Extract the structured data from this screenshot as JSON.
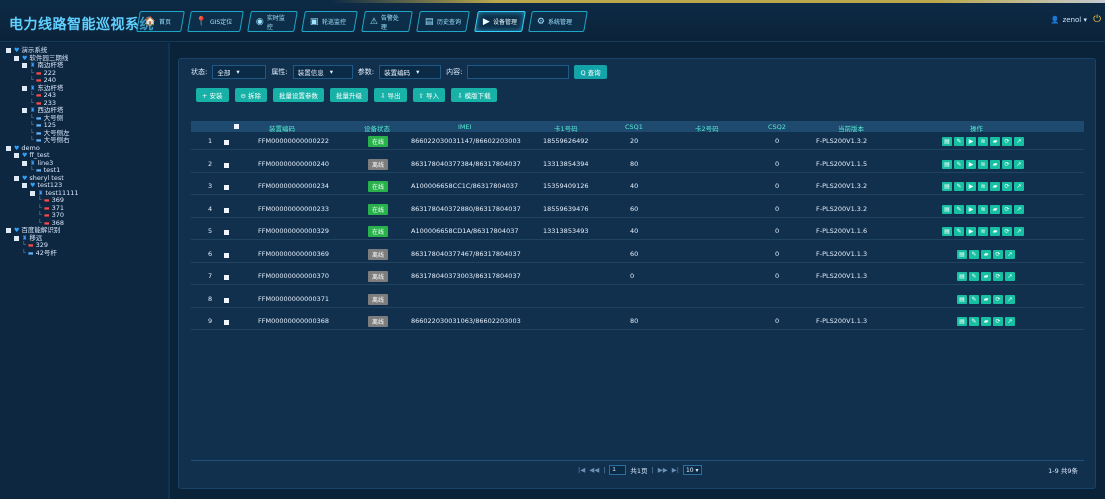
{
  "app_title": "电力线路智能巡视系统",
  "nav": [
    {
      "label": "首页",
      "icon": "home-icon",
      "glyph": "🏠"
    },
    {
      "label": "GIS定位",
      "icon": "map-pin-icon",
      "glyph": "📍"
    },
    {
      "label": "实时监控",
      "icon": "camera-icon",
      "glyph": "◉"
    },
    {
      "label": "轮巡监控",
      "icon": "video-icon",
      "glyph": "▣"
    },
    {
      "label": "告警处理",
      "icon": "warning-icon",
      "glyph": "⚠"
    },
    {
      "label": "历史查询",
      "icon": "calendar-icon",
      "glyph": "▤"
    },
    {
      "label": "设备管理",
      "icon": "device-icon",
      "glyph": "▶"
    },
    {
      "label": "系统管理",
      "icon": "gear-icon",
      "glyph": "⚙"
    }
  ],
  "user": {
    "name": "zenol ▾",
    "icon": "user-icon",
    "power_icon": "power-icon"
  },
  "tree": [
    {
      "t": "演示系统",
      "level": 0,
      "kind": "pin"
    },
    {
      "t": "软件园三期线",
      "level": 1,
      "kind": "pin"
    },
    {
      "t": "南边杆塔",
      "level": 2,
      "kind": "bar"
    },
    {
      "t": "222",
      "level": 3,
      "kind": "dev-red"
    },
    {
      "t": "240",
      "level": 3,
      "kind": "dev-red"
    },
    {
      "t": "东边杆塔",
      "level": 2,
      "kind": "bar"
    },
    {
      "t": "243",
      "level": 3,
      "kind": "dev-red"
    },
    {
      "t": "233",
      "level": 3,
      "kind": "dev-red"
    },
    {
      "t": "西边杆塔",
      "level": 2,
      "kind": "bar"
    },
    {
      "t": "大号侧",
      "level": 3,
      "kind": "dev-blue"
    },
    {
      "t": "125",
      "level": 3,
      "kind": "dev-blue"
    },
    {
      "t": "大号侧左",
      "level": 3,
      "kind": "dev-blue"
    },
    {
      "t": "大号侧右",
      "level": 3,
      "kind": "dev-blue"
    },
    {
      "t": "demo",
      "level": 0,
      "kind": "pin"
    },
    {
      "t": "ff_test",
      "level": 1,
      "kind": "pin"
    },
    {
      "t": "line3",
      "level": 2,
      "kind": "bar"
    },
    {
      "t": "test1",
      "level": 3,
      "kind": "dev-blue"
    },
    {
      "t": "sheryl test",
      "level": 1,
      "kind": "pin"
    },
    {
      "t": "test123",
      "level": 2,
      "kind": "pin"
    },
    {
      "t": "test11111",
      "level": 3,
      "kind": "bar"
    },
    {
      "t": "369",
      "level": 4,
      "kind": "dev-red"
    },
    {
      "t": "371",
      "level": 4,
      "kind": "dev-red"
    },
    {
      "t": "370",
      "level": 4,
      "kind": "dev-red"
    },
    {
      "t": "368",
      "level": 4,
      "kind": "dev-red"
    },
    {
      "t": "百度能解识别",
      "level": 0,
      "kind": "pin"
    },
    {
      "t": "移远",
      "level": 1,
      "kind": "bar"
    },
    {
      "t": "329",
      "level": 2,
      "kind": "dev-red"
    },
    {
      "t": "42号杆",
      "level": 2,
      "kind": "dev-blue"
    }
  ],
  "filters": {
    "status_label": "状态:",
    "status_value": "全部",
    "attr_label": "属性:",
    "attr_value": "装置信息",
    "param_label": "参数:",
    "param_value": "装置编码",
    "content_label": "内容:",
    "content_value": "",
    "query_label": "Q 查询"
  },
  "actions": [
    {
      "label": "+ 安装",
      "name": "install-button"
    },
    {
      "label": "⊖ 拆除",
      "name": "remove-button"
    },
    {
      "label": "批量设置参数",
      "name": "batch-params-button"
    },
    {
      "label": "批量升级",
      "name": "batch-upgrade-button"
    },
    {
      "label": "⇩ 导出",
      "name": "export-button"
    },
    {
      "label": "⇧ 导入",
      "name": "import-button"
    },
    {
      "label": "⇩ 模版下载",
      "name": "template-download-button"
    }
  ],
  "columns": [
    "装置编码",
    "设备状态",
    "IMEI",
    "卡1号码",
    "CSQ1",
    "卡2号码",
    "CSQ2",
    "当前版本",
    "操作"
  ],
  "rows": [
    {
      "no": "1",
      "code": "FFM00000000000222",
      "status": "在线",
      "online": true,
      "imei": "866022030031147/86602203003",
      "card1": "18559626492",
      "csq1": "20",
      "card2": "",
      "csq2": "0",
      "version": "F-PLS200V1.3.2",
      "ops": 6
    },
    {
      "no": "2",
      "code": "FFM00000000000240",
      "status": "离线",
      "online": false,
      "imei": "863178040377384/86317804037",
      "card1": "13313854394",
      "csq1": "80",
      "card2": "",
      "csq2": "0",
      "version": "F-PLS200V1.1.5",
      "ops": 6
    },
    {
      "no": "3",
      "code": "FFM00000000000234",
      "status": "在线",
      "online": true,
      "imei": "A100006658CC1C/86317804037",
      "card1": "15359409126",
      "csq1": "40",
      "card2": "",
      "csq2": "0",
      "version": "F-PLS200V1.3.2",
      "ops": 6
    },
    {
      "no": "4",
      "code": "FFM00000000000233",
      "status": "在线",
      "online": true,
      "imei": "863178040372880/86317804037",
      "card1": "18559639476",
      "csq1": "60",
      "card2": "",
      "csq2": "0",
      "version": "F-PLS200V1.3.2",
      "ops": 6
    },
    {
      "no": "5",
      "code": "FFM00000000000329",
      "status": "在线",
      "online": true,
      "imei": "A100006658CD1A/86317804037",
      "card1": "13313853493",
      "csq1": "40",
      "card2": "",
      "csq2": "0",
      "version": "F-PLS200V1.1.6",
      "ops": 6
    },
    {
      "no": "6",
      "code": "FFM00000000000369",
      "status": "离线",
      "online": false,
      "imei": "863178040377467/86317804037",
      "card1": "",
      "csq1": "60",
      "card2": "",
      "csq2": "0",
      "version": "F-PLS200V1.1.3",
      "ops": 4
    },
    {
      "no": "7",
      "code": "FFM00000000000370",
      "status": "离线",
      "online": false,
      "imei": "863178040373003/86317804037",
      "card1": "",
      "csq1": "0",
      "card2": "",
      "csq2": "0",
      "version": "F-PLS200V1.1.3",
      "ops": 4
    },
    {
      "no": "8",
      "code": "FFM00000000000371",
      "status": "离线",
      "online": false,
      "imei": "",
      "card1": "",
      "csq1": "",
      "card2": "",
      "csq2": "",
      "version": "",
      "ops": 4
    },
    {
      "no": "9",
      "code": "FFM00000000000368",
      "status": "离线",
      "online": false,
      "imei": "866022030031063/86602203003",
      "card1": "",
      "csq1": "80",
      "card2": "",
      "csq2": "0",
      "version": "F-PLS200V1.1.3",
      "ops": 4
    }
  ],
  "op_icons": [
    "▤",
    "✎",
    "▶",
    "≋",
    "▰",
    "⟳",
    "↗"
  ],
  "pager": {
    "first": "|◀",
    "prev": "◀◀",
    "page": "1",
    "of_pages": "共1页",
    "next": "▶▶",
    "last": "▶|",
    "page_size": "10 ▾",
    "count": "1-9  共9条"
  },
  "colors": {
    "accent": "#17b1a7",
    "online": "#29b24c",
    "offline": "#7d7d7d",
    "header_text": "#53ecd4"
  }
}
